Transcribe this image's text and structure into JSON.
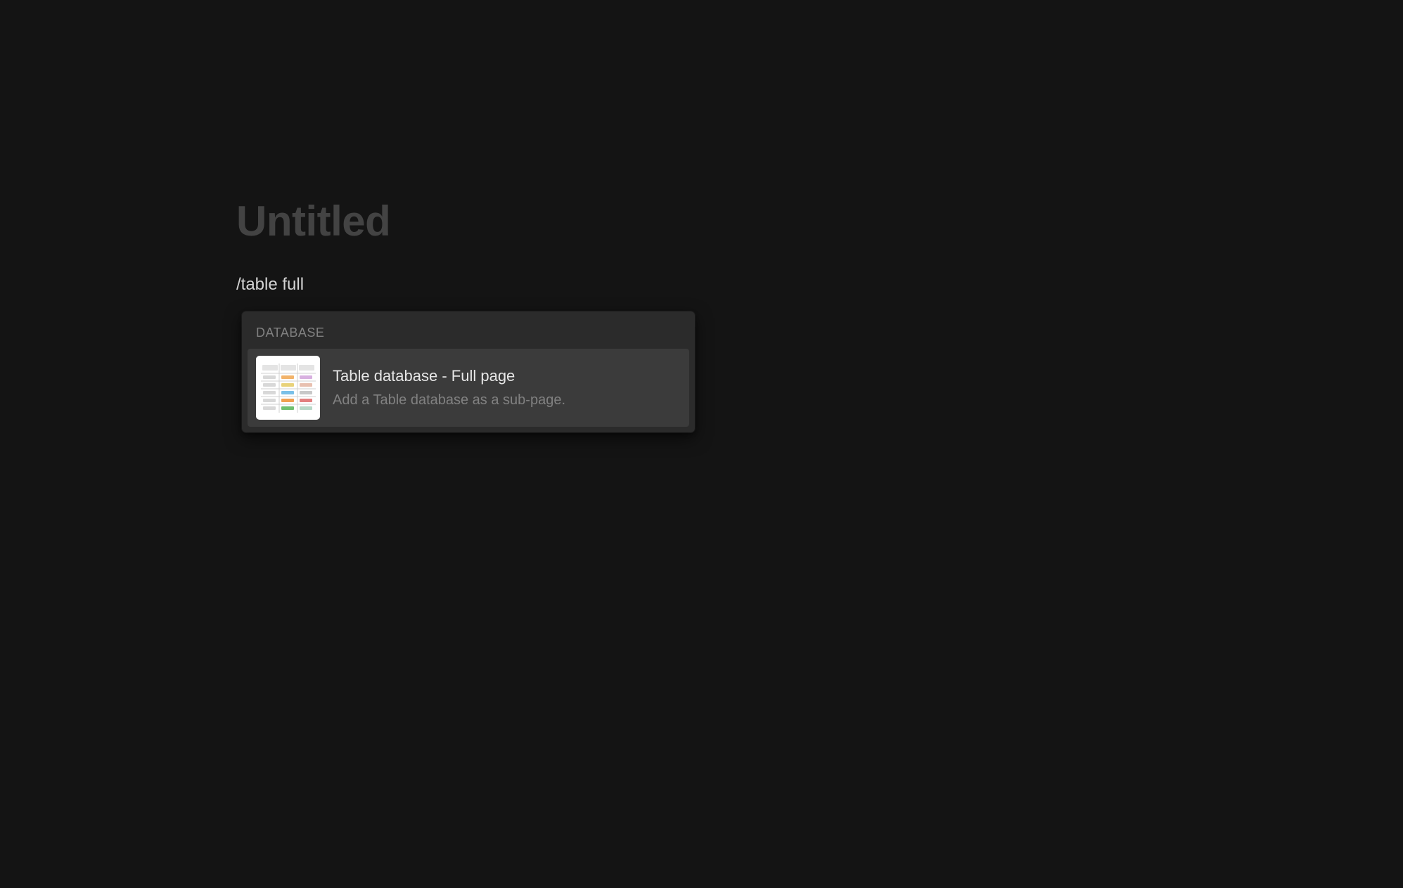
{
  "page": {
    "title": "Untitled",
    "command_text": "/table full"
  },
  "popup": {
    "section_heading": "DATABASE",
    "items": [
      {
        "title": "Table database - Full page",
        "description": "Add a Table database as a sub-page."
      }
    ]
  }
}
